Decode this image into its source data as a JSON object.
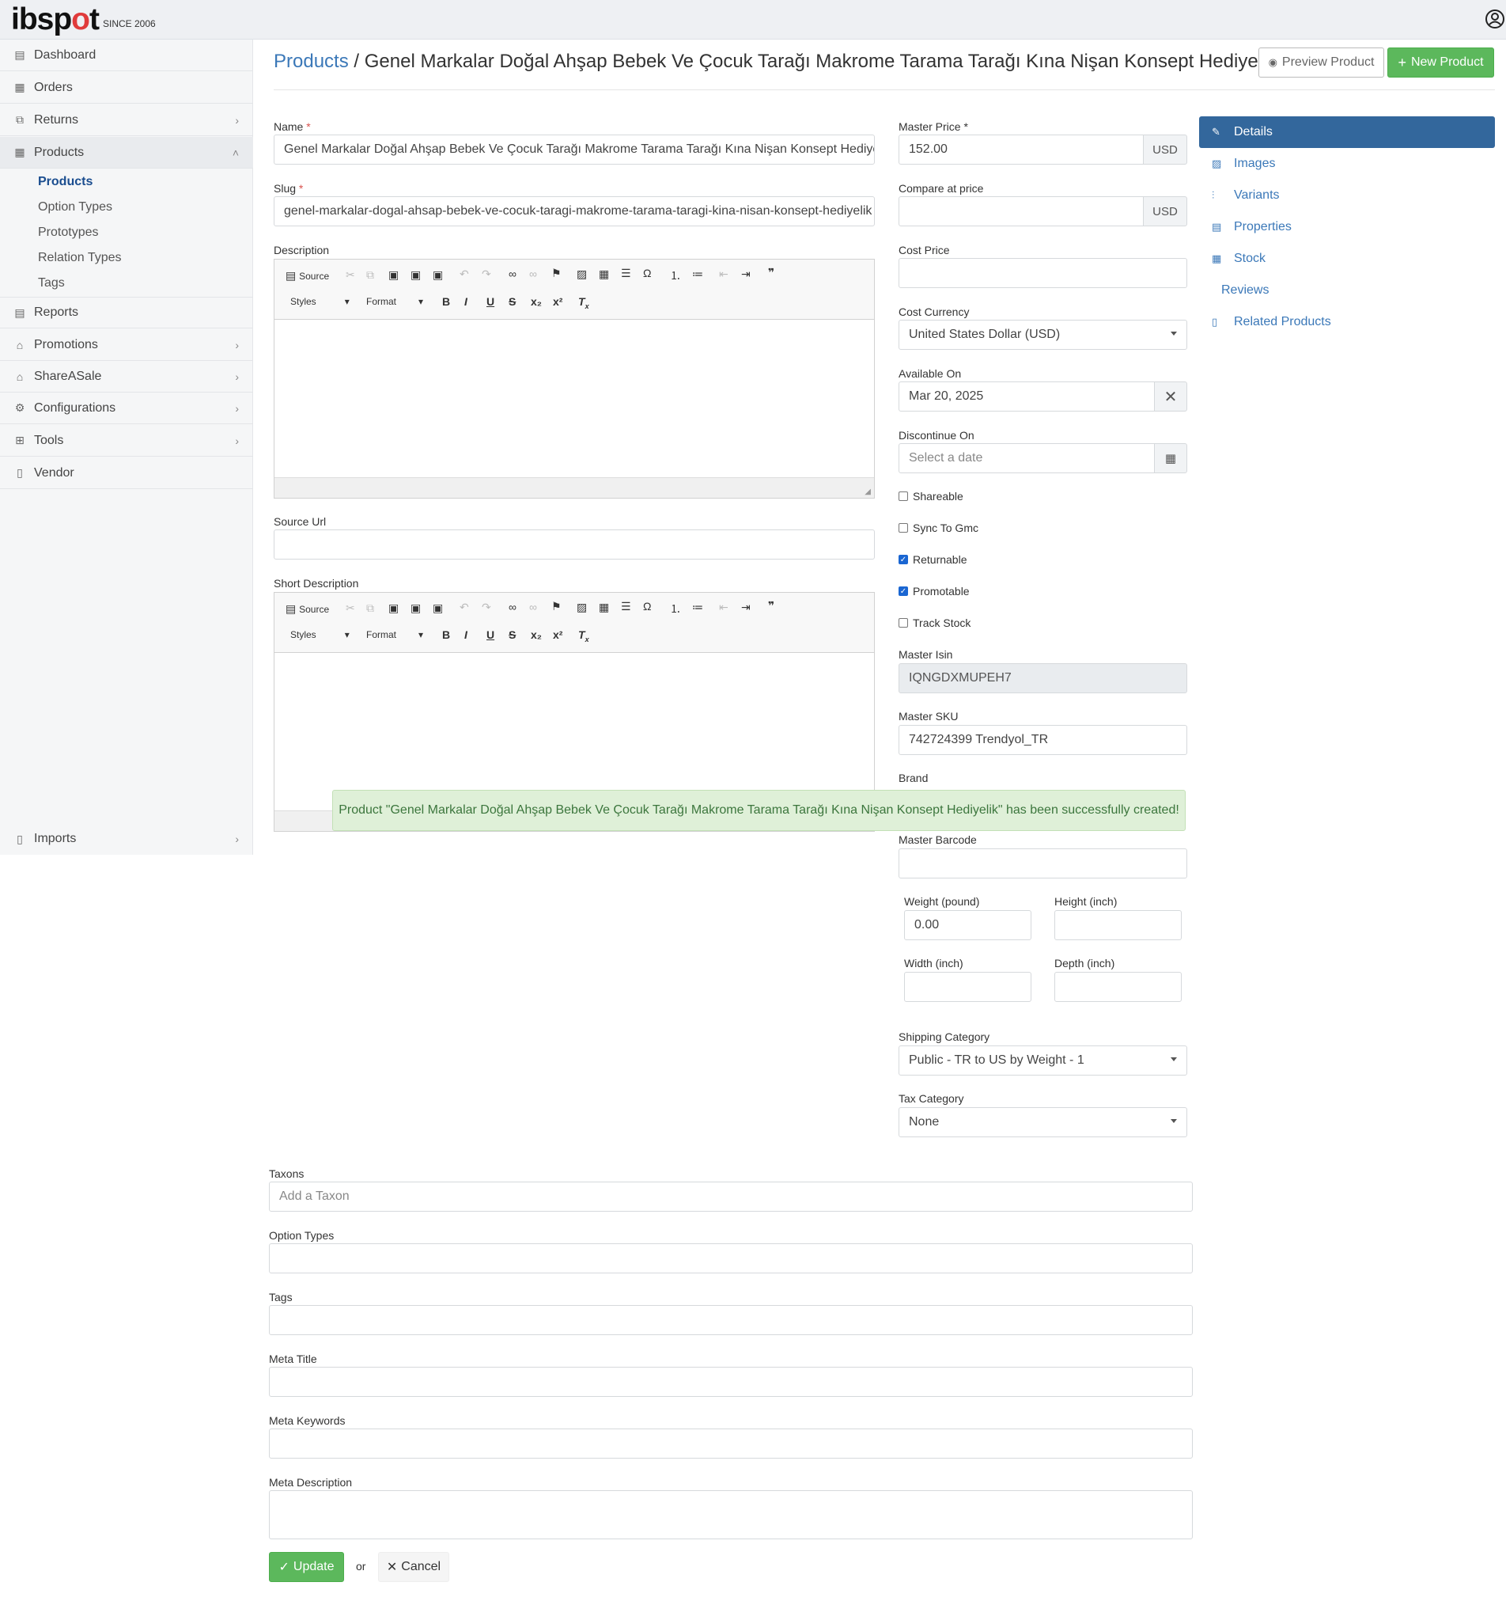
{
  "header": {
    "logo_text": "ibspot",
    "logo_since": "SINCE 2006"
  },
  "sidebar": {
    "items": [
      {
        "label": "Dashboard",
        "icon": "dashboard-icon"
      },
      {
        "label": "Orders",
        "icon": "orders-icon"
      },
      {
        "label": "Returns",
        "icon": "returns-icon"
      },
      {
        "label": "Products",
        "icon": "products-icon"
      },
      {
        "label": "Reports",
        "icon": "reports-icon"
      },
      {
        "label": "Promotions",
        "icon": "promotions-icon"
      },
      {
        "label": "ShareASale",
        "icon": "tag-icon"
      },
      {
        "label": "Configurations",
        "icon": "gear-icon"
      },
      {
        "label": "Tools",
        "icon": "tools-icon"
      },
      {
        "label": "Vendor",
        "icon": "vendor-icon"
      },
      {
        "label": "Imports",
        "icon": "imports-icon"
      }
    ],
    "product_sub": [
      "Products",
      "Option Types",
      "Prototypes",
      "Relation Types",
      "Tags"
    ]
  },
  "page": {
    "crumb": "Products",
    "separator": " / ",
    "title": "Genel Markalar Doğal Ahşap Bebek Ve Çocuk Tarağı Makrome Tarama Tarağı Kına Nişan Konsept Hediyelik",
    "preview_label": "Preview Product",
    "new_label": "New Product"
  },
  "form": {
    "name_label": "Name",
    "name_value": "Genel Markalar Doğal Ahşap Bebek Ve Çocuk Tarağı Makrome Tarama Tarağı Kına Nişan Konsept Hediyelik",
    "slug_label": "Slug",
    "slug_value": "genel-markalar-dogal-ahsap-bebek-ve-cocuk-taragi-makrome-tarama-taragi-kina-nisan-konsept-hediyelik",
    "description_label": "Description",
    "source_url_label": "Source Url",
    "short_description_label": "Short Description",
    "toolbar": {
      "source": "Source",
      "styles": "Styles",
      "format": "Format"
    },
    "master_price_label": "Master Price",
    "master_price_value": "152.00",
    "currency_addon": "USD",
    "compare_label": "Compare at price",
    "cost_price_label": "Cost Price",
    "cost_currency_label": "Cost Currency",
    "cost_currency_value": "United States Dollar (USD)",
    "available_on_label": "Available On",
    "available_on_value": "Mar 20, 2025",
    "discontinue_label": "Discontinue On",
    "discontinue_placeholder": "Select a date",
    "checkboxes": [
      {
        "label": "Shareable",
        "checked": false
      },
      {
        "label": "Sync To Gmc",
        "checked": false
      },
      {
        "label": "Returnable",
        "checked": true
      },
      {
        "label": "Promotable",
        "checked": true
      },
      {
        "label": "Track Stock",
        "checked": false
      }
    ],
    "master_isin_label": "Master Isin",
    "master_isin_value": "IQNGDXMUPEH7",
    "master_sku_label": "Master SKU",
    "master_sku_value": "742724399 Trendyol_TR",
    "brand_label": "Brand",
    "master_barcode_label": "Master Barcode",
    "weight_label": "Weight (pound)",
    "weight_value": "0.00",
    "height_label": "Height (inch)",
    "width_label": "Width (inch)",
    "depth_label": "Depth (inch)",
    "shipping_category_label": "Shipping Category",
    "shipping_category_value": "Public - TR to US by Weight - 1",
    "tax_category_label": "Tax Category",
    "tax_category_value": "None",
    "taxons_label": "Taxons",
    "taxons_placeholder": "Add a Taxon",
    "option_types_label": "Option Types",
    "tags_label": "Tags",
    "meta_title_label": "Meta Title",
    "meta_keywords_label": "Meta Keywords",
    "meta_description_label": "Meta Description",
    "update_label": "Update",
    "or_text": "or",
    "cancel_label": "Cancel",
    "required_mark": "*"
  },
  "tabs": [
    {
      "label": "Details",
      "icon": "pencil-icon"
    },
    {
      "label": "Images",
      "icon": "image-icon"
    },
    {
      "label": "Variants",
      "icon": "sliders-icon"
    },
    {
      "label": "Properties",
      "icon": "list-icon"
    },
    {
      "label": "Stock",
      "icon": "grid-icon"
    },
    {
      "label": "Reviews",
      "icon": ""
    },
    {
      "label": "Related Products",
      "icon": "file-icon"
    }
  ],
  "alert": {
    "message": "Product \"Genel Markalar Doğal Ahşap Bebek Ve Çocuk Tarağı Makrome Tarama Tarağı Kına Nişan Konsept Hediyelik\" has been successfully created!"
  }
}
